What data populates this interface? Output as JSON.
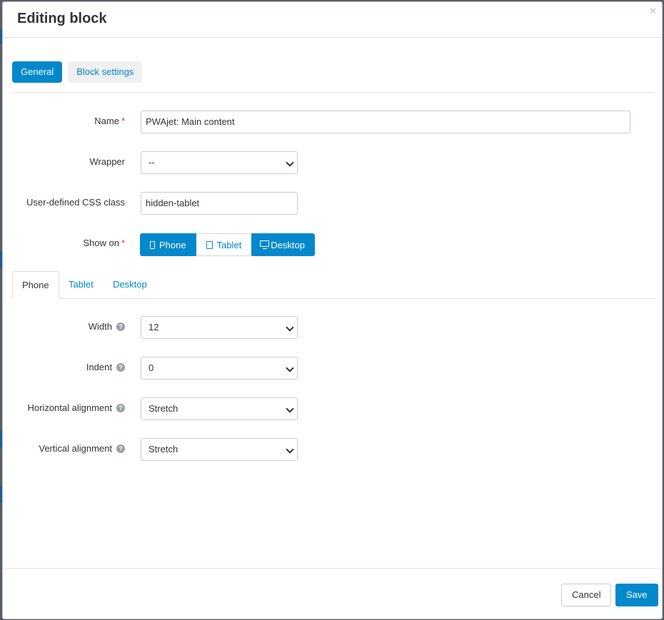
{
  "modal": {
    "title": "Editing block",
    "close_glyph": "×",
    "close_icon": "close-icon"
  },
  "top_tabs": [
    {
      "label": "General",
      "active": true
    },
    {
      "label": "Block settings",
      "active": false
    }
  ],
  "form": {
    "name_label": "Name",
    "required_mark": "*",
    "name_value": "PWAjet: Main content",
    "wrapper_label": "Wrapper",
    "wrapper_value": "--",
    "css_class_label": "User-defined CSS class",
    "css_class_value": "hidden-tablet",
    "show_on_label": "Show on",
    "show_on": [
      {
        "label": "Phone",
        "icon": "phone-icon",
        "selected": true
      },
      {
        "label": "Tablet",
        "icon": "tablet-icon",
        "selected": false
      },
      {
        "label": "Desktop",
        "icon": "desktop-icon",
        "selected": true
      }
    ]
  },
  "device_tabs": [
    {
      "label": "Phone",
      "active": true
    },
    {
      "label": "Tablet",
      "active": false
    },
    {
      "label": "Desktop",
      "active": false
    }
  ],
  "device_settings": {
    "width_label": "Width",
    "width_value": "12",
    "indent_label": "Indent",
    "indent_value": "0",
    "halign_label": "Horizontal alignment",
    "halign_value": "Stretch",
    "valign_label": "Vertical alignment",
    "valign_value": "Stretch",
    "help_glyph": "?"
  },
  "footer": {
    "cancel_label": "Cancel",
    "save_label": "Save"
  },
  "colors": {
    "accent": "#0388cc",
    "required": "#d9363e",
    "pill_inactive_bg": "#eef0f2",
    "overlay": "#5a5f66"
  }
}
